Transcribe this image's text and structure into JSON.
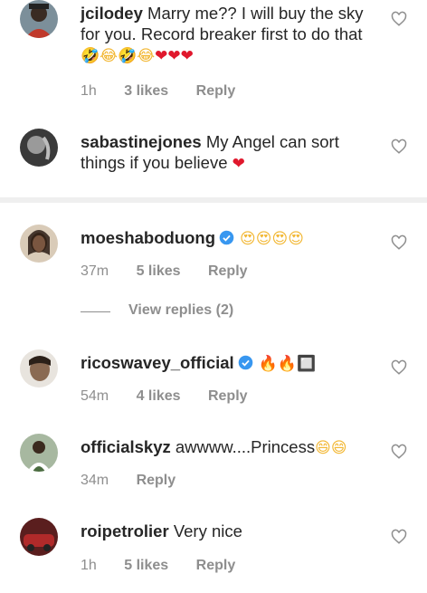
{
  "comments": [
    {
      "username": "jcilodey",
      "text": "Marry me?? I will buy the sky for you. Record breaker first to do that",
      "emojis": [
        "🤣",
        "😂",
        "🤣",
        "😂",
        "❤",
        "❤",
        "❤"
      ],
      "time": "1h",
      "likes": "3 likes",
      "reply": "Reply"
    },
    {
      "username": "sabastinejones",
      "text": "My Angel can sort things if you believe",
      "emojis": [
        "❤"
      ]
    },
    {
      "username": "moeshaboduong",
      "verified": true,
      "emojis": [
        "😍",
        "😍",
        "😍",
        "😍"
      ],
      "time": "37m",
      "likes": "5 likes",
      "reply": "Reply",
      "view_replies": "View replies (2)"
    },
    {
      "username": "ricoswavey_official",
      "verified": true,
      "emojis": [
        "🔥",
        "🔥",
        "🔲"
      ],
      "time": "54m",
      "likes": "4 likes",
      "reply": "Reply"
    },
    {
      "username": "officialskyz",
      "text": "awwww....Princess",
      "emojis": [
        "😄",
        "😄"
      ],
      "time": "34m",
      "reply": "Reply"
    },
    {
      "username": "roipetrolier",
      "text": "Very nice",
      "time": "1h",
      "likes": "5 likes",
      "reply": "Reply"
    }
  ],
  "icons": {
    "like": "heart-outline-icon",
    "verified": "verified-badge-icon"
  },
  "colors": {
    "verified": "#3897f0",
    "heart": "#e0182d",
    "meta": "#8e8e8e",
    "divider": "#efefef"
  }
}
